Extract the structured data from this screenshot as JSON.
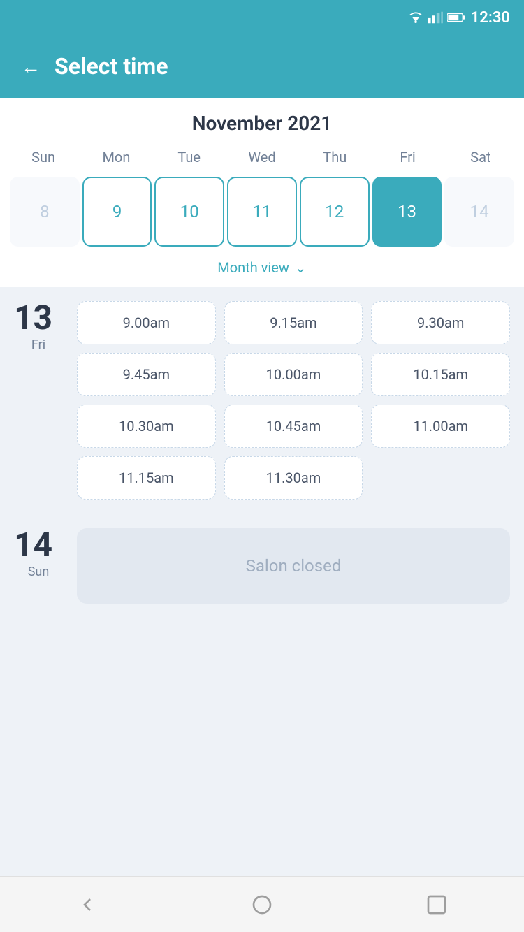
{
  "statusBar": {
    "time": "12:30"
  },
  "header": {
    "title": "Select time",
    "backLabel": "←"
  },
  "calendar": {
    "monthYear": "November 2021",
    "weekdays": [
      "Sun",
      "Mon",
      "Tue",
      "Wed",
      "Thu",
      "Fri",
      "Sat"
    ],
    "days": [
      {
        "number": "8",
        "state": "inactive"
      },
      {
        "number": "9",
        "state": "active"
      },
      {
        "number": "10",
        "state": "active"
      },
      {
        "number": "11",
        "state": "active"
      },
      {
        "number": "12",
        "state": "active"
      },
      {
        "number": "13",
        "state": "selected"
      },
      {
        "number": "14",
        "state": "inactive"
      }
    ],
    "monthViewLabel": "Month view"
  },
  "timeSection": {
    "day13": {
      "number": "13",
      "name": "Fri",
      "slots": [
        "9.00am",
        "9.15am",
        "9.30am",
        "9.45am",
        "10.00am",
        "10.15am",
        "10.30am",
        "10.45am",
        "11.00am",
        "11.15am",
        "11.30am"
      ]
    },
    "day14": {
      "number": "14",
      "name": "Sun",
      "closedText": "Salon closed"
    }
  },
  "bottomNav": {
    "back": "back",
    "home": "home",
    "recents": "recents"
  }
}
